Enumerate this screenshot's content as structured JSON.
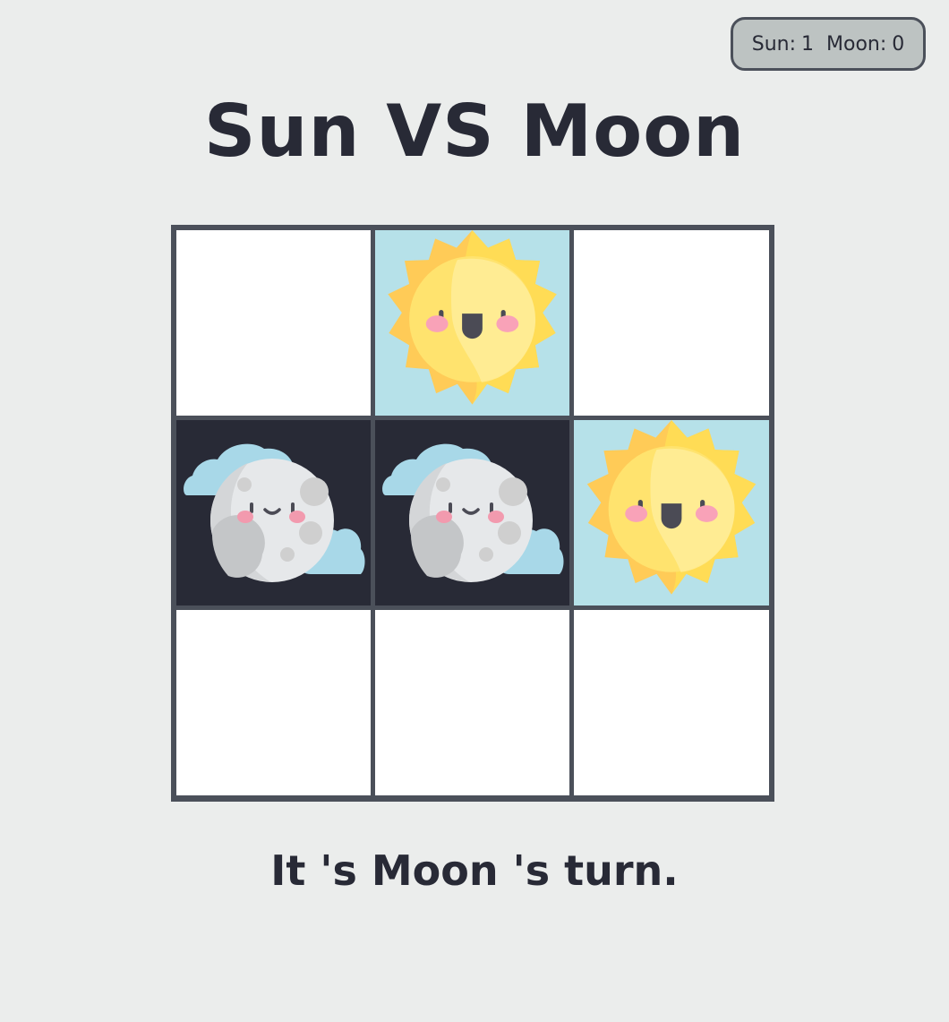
{
  "scoreboard": {
    "sun_label": "Sun:",
    "sun_score": "1",
    "moon_label": "Moon:",
    "moon_score": "0"
  },
  "title": "Sun VS Moon",
  "board": {
    "cells": [
      "",
      "sun",
      "",
      "moon",
      "moon",
      "sun",
      "",
      "",
      ""
    ],
    "piece_icons": {
      "sun": "sun-icon",
      "moon": "moon-icon"
    }
  },
  "status": "It 's Moon 's turn.",
  "colors": {
    "background": "#EBEDEC",
    "board_lines": "#4B505A",
    "sun_cell": "#B6E1E9",
    "moon_cell": "#282A36",
    "empty_cell": "#FFFFFF",
    "text": "#282A36",
    "scoreboard": "#BDC3C2"
  }
}
